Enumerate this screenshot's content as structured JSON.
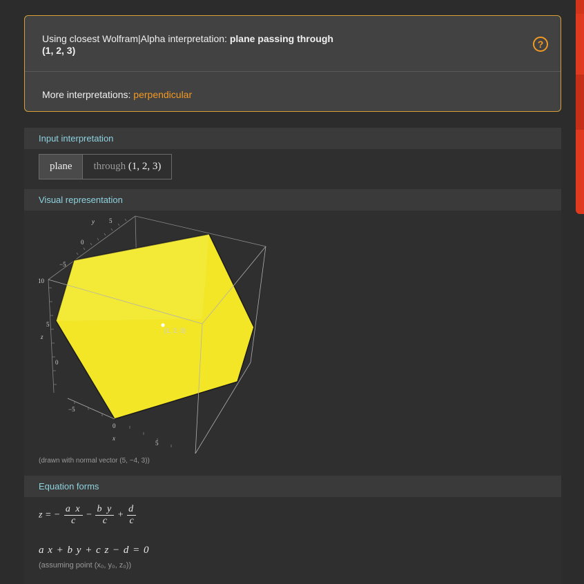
{
  "interpretation": {
    "prefix": "Using closest Wolfram|Alpha interpretation: ",
    "bold_line1": "plane passing through",
    "bold_line2": "(1, 2, 3)",
    "help_icon": "question-circle-icon",
    "more_label": "More interpretations: ",
    "more_link": "perpendicular"
  },
  "pods": {
    "input": {
      "title": "Input interpretation",
      "cell1": "plane",
      "cell2_dim": "through",
      "cell2_value": " (1, 2, 3)"
    },
    "visual": {
      "title": "Visual representation",
      "point_label": "(1, 2, 3)",
      "axis_y": "y",
      "axis_z": "z",
      "axis_x": "x",
      "ticks_y": [
        "5",
        "0",
        "−5"
      ],
      "ticks_z": [
        "10",
        "5",
        "0"
      ],
      "ticks_x": [
        "−5",
        "0",
        "5"
      ],
      "caption": "(drawn with normal vector (5, −4, 3))",
      "plane_color": "#f2e626"
    },
    "equations": {
      "title": "Equation forms",
      "eq1_lhs": "z = −",
      "eq1_f1_num": "a x",
      "eq1_f1_den": "c",
      "eq1_op1": "−",
      "eq1_f2_num": "b y",
      "eq1_f2_den": "c",
      "eq1_op2": "+",
      "eq1_f3_num": "d",
      "eq1_f3_den": "c",
      "eq2": "a x + b y + c z − d = 0",
      "note": "(assuming point (x₀, y₀, z₀))"
    }
  },
  "colors": {
    "accent": "#f29a23",
    "header_text": "#8ed3e0",
    "border_gold": "#d8a036"
  }
}
